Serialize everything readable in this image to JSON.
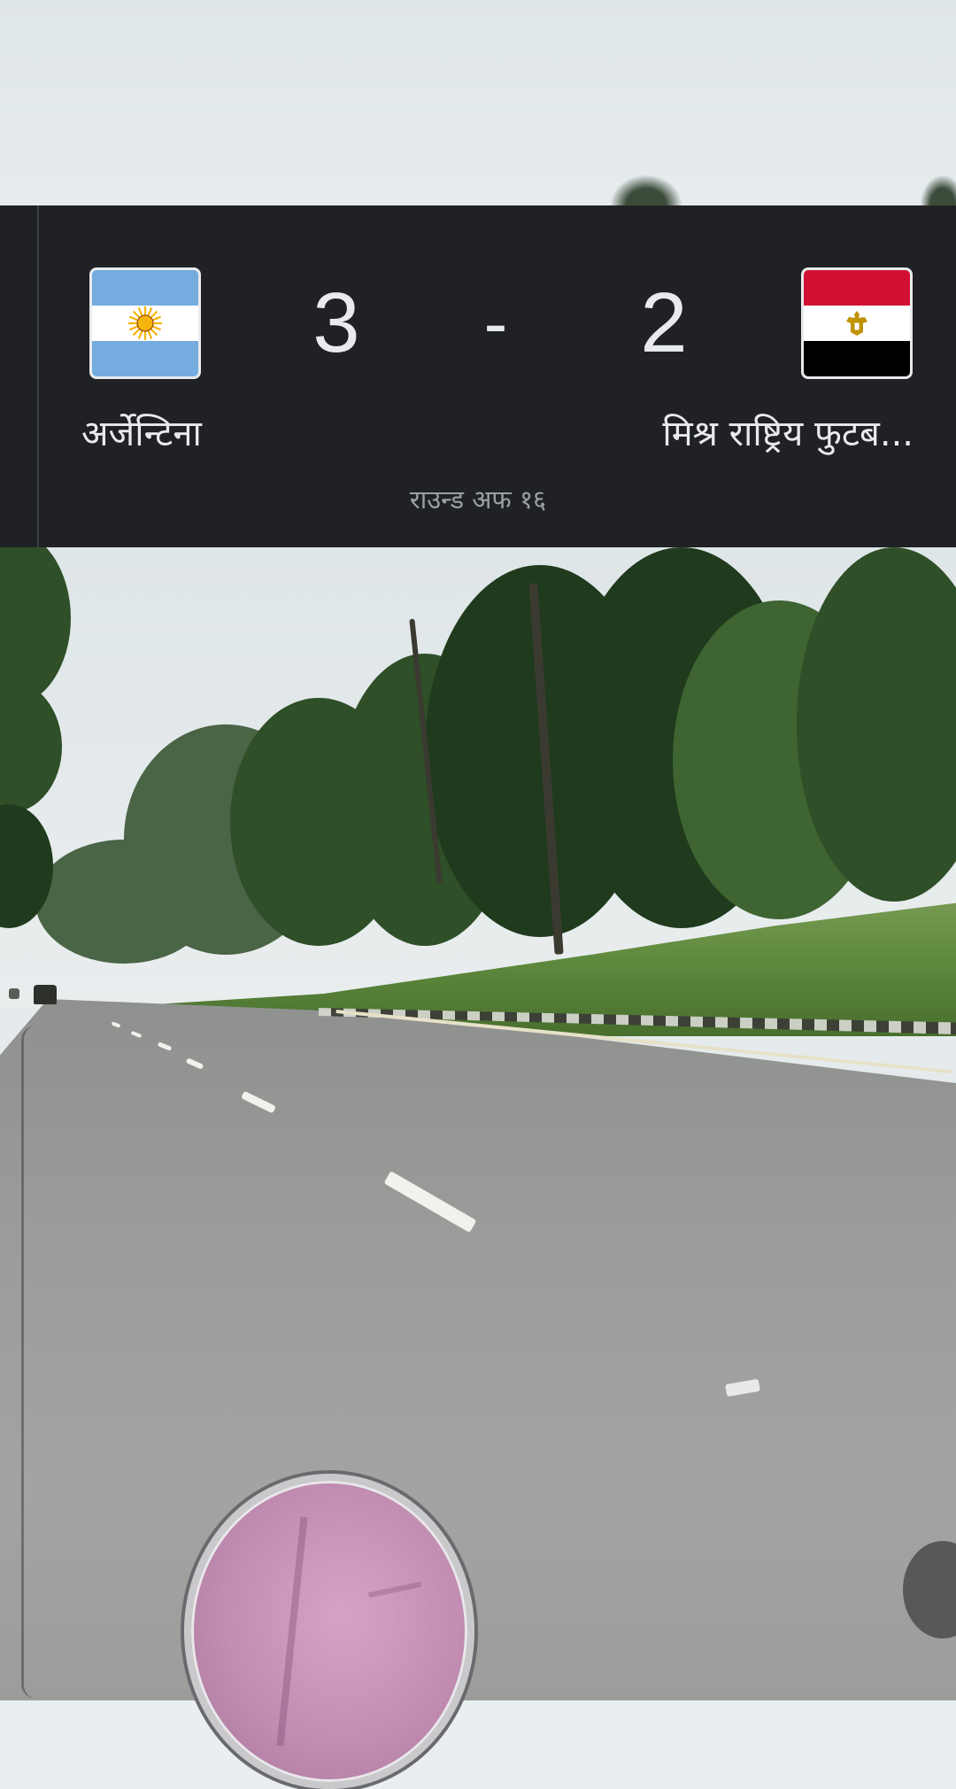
{
  "match": {
    "home_team": {
      "name": "अर्जेन्टिना",
      "score": "3",
      "flag_icon": "argentina-flag-icon"
    },
    "away_team": {
      "name": "मिश्र राष्ट्रिय फुटब...",
      "score": "2",
      "flag_icon": "egypt-flag-icon"
    },
    "separator": "-",
    "stage": "राउन्ड अफ १६"
  },
  "colors": {
    "card_background": "#202124",
    "primary_text": "#e8eaed",
    "secondary_text": "#9aa0a6"
  }
}
